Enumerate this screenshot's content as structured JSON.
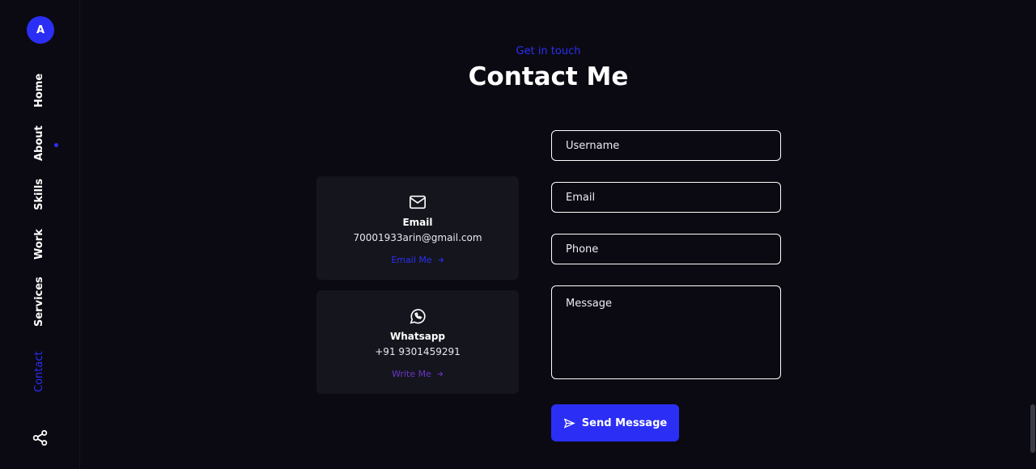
{
  "sidebar": {
    "logo_letter": "A",
    "items": [
      {
        "label": "Home"
      },
      {
        "label": "About"
      },
      {
        "label": "Skills"
      },
      {
        "label": "Work"
      },
      {
        "label": "Services"
      },
      {
        "label": "Contact"
      }
    ],
    "active_item": "Contact",
    "share_icon": "share-icon"
  },
  "header": {
    "subtitle": "Get in touch",
    "title": "Contact Me"
  },
  "cards": [
    {
      "icon": "mail-icon",
      "title": "Email",
      "value": "70001933arin@gmail.com",
      "link": "Email Me"
    },
    {
      "icon": "whatsapp-icon",
      "title": "Whatsapp",
      "value": "+91 9301459291",
      "link": "Write Me"
    }
  ],
  "form": {
    "username_placeholder": "Username",
    "email_placeholder": "Email",
    "phone_placeholder": "Phone",
    "message_placeholder": "Message",
    "submit_label": "Send Message"
  },
  "colors": {
    "background": "#0b0a12",
    "accent": "#2b2ff5",
    "card": "#15151d",
    "link_purple": "#6a35c8"
  }
}
